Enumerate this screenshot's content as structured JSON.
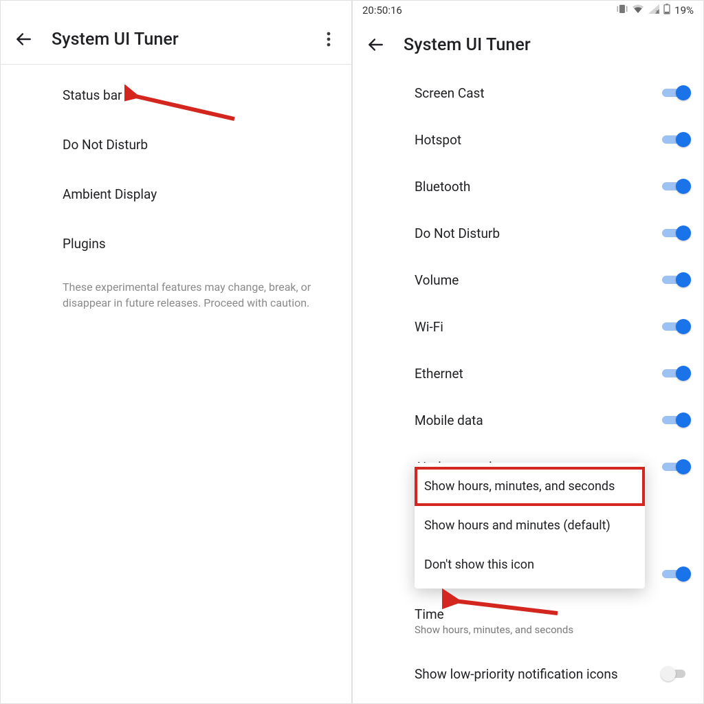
{
  "left": {
    "appbar": {
      "title": "System UI Tuner"
    },
    "items": [
      {
        "label": "Status bar"
      },
      {
        "label": "Do Not Disturb"
      },
      {
        "label": "Ambient Display"
      },
      {
        "label": "Plugins"
      }
    ],
    "footnote": "These experimental features may change, break, or disappear in future releases. Proceed with caution."
  },
  "right": {
    "statusbar": {
      "time": "20:50:16",
      "battery": "19%"
    },
    "appbar": {
      "title": "System UI Tuner"
    },
    "toggles": [
      {
        "label": "Screen Cast",
        "on": true
      },
      {
        "label": "Hotspot",
        "on": true
      },
      {
        "label": "Bluetooth",
        "on": true
      },
      {
        "label": "Do Not Disturb",
        "on": true
      },
      {
        "label": "Volume",
        "on": true
      },
      {
        "label": "Wi-Fi",
        "on": true
      },
      {
        "label": "Ethernet",
        "on": true
      },
      {
        "label": "Mobile data",
        "on": true
      },
      {
        "label": "Airplane mode",
        "on": true
      }
    ],
    "dropdown": {
      "options": [
        "Show hours, minutes, and seconds",
        "Show hours and minutes (default)",
        "Don't show this icon"
      ]
    },
    "hidden_toggle_on": true,
    "time_row": {
      "label": "Time",
      "sub": "Show hours, minutes, and seconds"
    },
    "low_priority": {
      "label": "Show low-priority notification icons",
      "on": false
    }
  }
}
